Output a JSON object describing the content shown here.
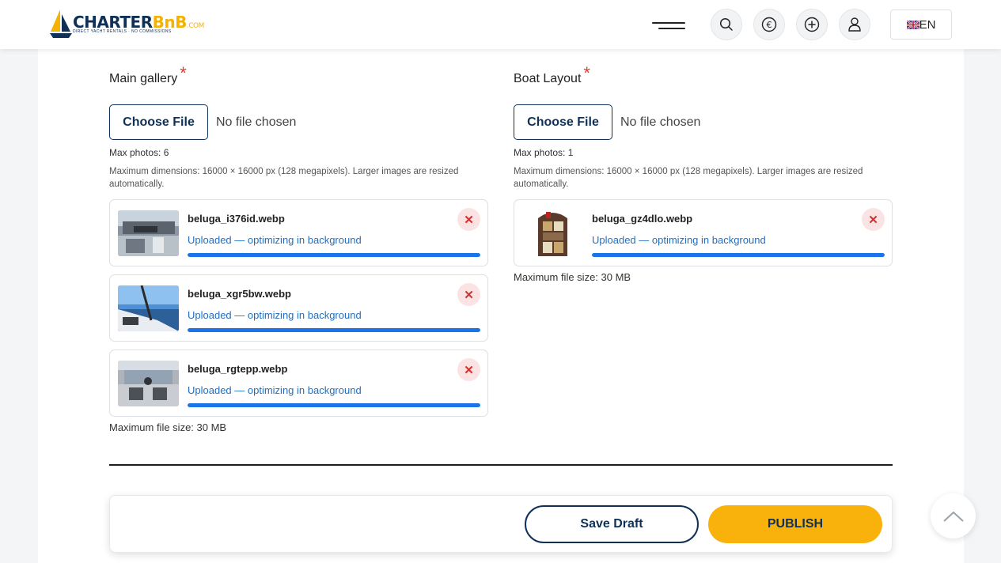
{
  "header": {
    "logo_text_part1": "CHARTER",
    "logo_text_part2": "BnB",
    "logo_text_part3": ".COM",
    "logo_tagline": "DIRECT YACHT RENTALS · NO COMMISSIONS",
    "icons": [
      "menu-icon",
      "search-icon",
      "currency-euro-icon",
      "add-circle-icon",
      "user-icon"
    ],
    "language": "EN"
  },
  "main_gallery": {
    "title": "Main gallery",
    "required_mark": "*",
    "choose_file_label": "Choose File",
    "no_file_text": "No file chosen",
    "max_photos": "Max photos: 6",
    "dimensions_note": "Maximum dimensions: 16000 × 16000 px (128 megapixels). Larger images are resized automatically.",
    "files": [
      {
        "name": "beluga_i376id.webp",
        "status": "Uploaded — optimizing in background",
        "progress": 1.0
      },
      {
        "name": "beluga_xgr5bw.webp",
        "status": "Uploaded — optimizing in background",
        "progress": 1.0
      },
      {
        "name": "beluga_rgtepp.webp",
        "status": "Uploaded — optimizing in background",
        "progress": 1.0
      }
    ],
    "max_file_size": "Maximum file size: 30 MB"
  },
  "boat_layout": {
    "title": "Boat Layout",
    "required_mark": "*",
    "choose_file_label": "Choose File",
    "no_file_text": "No file chosen",
    "max_photos": "Max photos: 1",
    "dimensions_note": "Maximum dimensions: 16000 × 16000 px (128 megapixels). Larger images are resized automatically.",
    "files": [
      {
        "name": "beluga_gz4dlo.webp",
        "status": "Uploaded — optimizing in background",
        "progress": 1.0
      }
    ],
    "max_file_size": "Maximum file size: 30 MB"
  },
  "actions": {
    "save_draft": "Save Draft",
    "publish": "PUBLISH"
  },
  "colors": {
    "navy": "#0f3057",
    "accent_yellow": "#f9b10b",
    "progress_blue": "#1a73e8",
    "status_blue": "#1f6fc4",
    "required_red": "#e23b3b"
  }
}
